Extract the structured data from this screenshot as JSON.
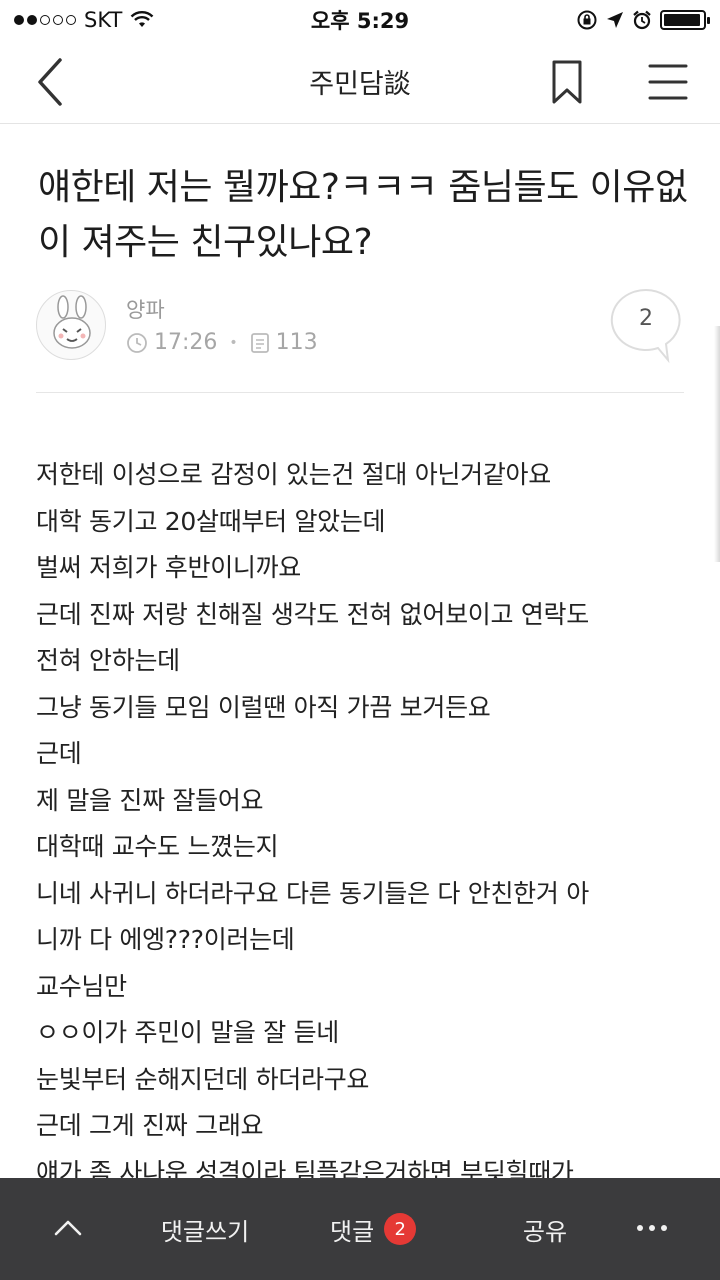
{
  "status_bar": {
    "carrier": "SKT",
    "time": "오후 5:29",
    "battery_level": 0.95
  },
  "nav": {
    "title": "주민담談"
  },
  "article": {
    "title": "얘한테 저는 뭘까요?ㅋㅋㅋ 줌님들도 이유없이 져주는 친구있나요?",
    "author": "양파",
    "time": "17:26",
    "views": "113",
    "comment_count": "2",
    "body_lines": [
      "저한테 이성으로 감정이 있는건 절대 아닌거같아요",
      "대학 동기고 20살때부터 알았는데",
      "벌써 저희가 후반이니까요",
      "근데 진짜 저랑 친해질 생각도 전혀 없어보이고 연락도",
      "전혀 안하는데",
      "그냥 동기들 모임 이럴땐 아직 가끔 보거든요",
      "근데",
      "제 말을 진짜 잘들어요",
      "대학때 교수도 느꼈는지",
      "니네 사귀니 하더라구요 다른 동기들은 다 안친한거 아",
      "니까 다 에엥???이러는데",
      "교수님만",
      "ㅇㅇ이가 주민이 말을 잘 듣네",
      "눈빛부터 순해지던데 하더라구요",
      "근데 그게 진짜 그래요",
      "얘가 좀 사나운 성격이라 팀플같은거하면 부딪힐때가"
    ]
  },
  "bottom_bar": {
    "write_label": "댓글쓰기",
    "comments_label": "댓글",
    "comments_badge": "2",
    "share_label": "공유"
  },
  "icons": {
    "back": "chevron-left-icon",
    "bookmark": "bookmark-icon",
    "menu": "hamburger-menu-icon",
    "clock": "clock-icon",
    "views": "document-icon",
    "comment": "speech-bubble-icon",
    "up": "chevron-up-icon",
    "more": "more-dots-icon"
  },
  "colors": {
    "bottom_bar_bg": "#3b3b3d",
    "badge": "#e53935",
    "meta_text": "#a6a6a6"
  }
}
